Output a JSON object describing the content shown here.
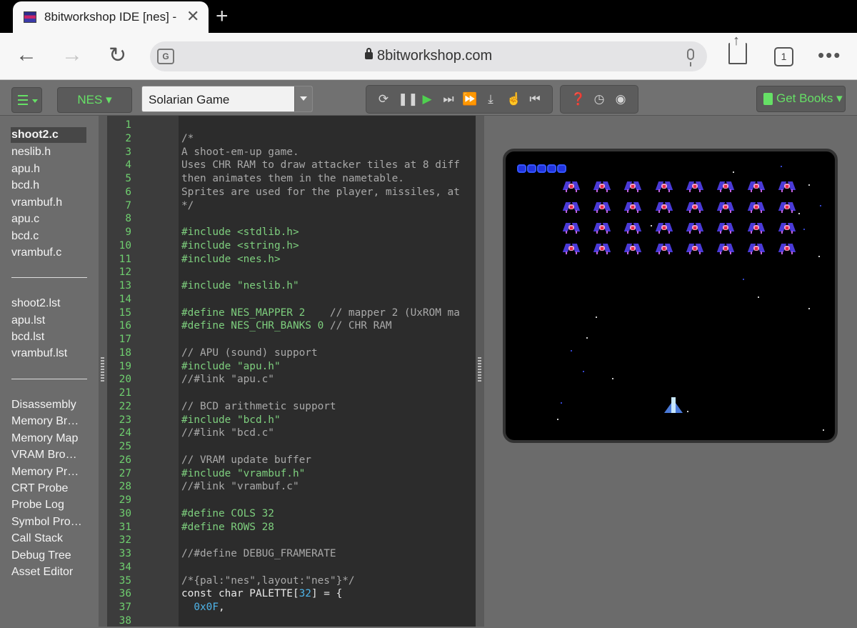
{
  "browser": {
    "tab_title": "8bitworkshop IDE [nes] - ",
    "url": "8bitworkshop.com",
    "tab_count": "1"
  },
  "ide": {
    "platform": "NES",
    "preset": "Solarian Game",
    "books": "Get Books",
    "controls": [
      "reset-icon",
      "pause-icon",
      "play-icon",
      "step-icon",
      "fast-forward-icon",
      "download-icon",
      "touch-icon",
      "rewind-icon"
    ],
    "debug_controls": [
      "help-icon",
      "clock-icon",
      "record-icon"
    ]
  },
  "sidebar": {
    "sources": [
      "shoot2.c",
      "neslib.h",
      "apu.h",
      "bcd.h",
      "vrambuf.h",
      "apu.c",
      "bcd.c",
      "vrambuf.c"
    ],
    "listings": [
      "shoot2.lst",
      "apu.lst",
      "bcd.lst",
      "vrambuf.lst"
    ],
    "tools": [
      "Disassembly",
      "Memory Br…",
      "Memory Map",
      "VRAM Bro…",
      "Memory Pr…",
      "CRT Probe",
      "Probe Log",
      "Symbol Pro…",
      "Call Stack",
      "Debug Tree",
      "Asset Editor"
    ],
    "active": "shoot2.c"
  },
  "editor": {
    "lines": [
      {
        "n": "1",
        "t": "",
        "c": "t-plain"
      },
      {
        "n": "2",
        "t": "/*",
        "c": "t-comment"
      },
      {
        "n": "3",
        "t": "A shoot-em-up game.",
        "c": "t-comment"
      },
      {
        "n": "4",
        "t": "Uses CHR RAM to draw attacker tiles at 8 diff",
        "c": "t-comment"
      },
      {
        "n": "5",
        "t": "then animates them in the nametable.",
        "c": "t-comment"
      },
      {
        "n": "6",
        "t": "Sprites are used for the player, missiles, at",
        "c": "t-comment"
      },
      {
        "n": "7",
        "t": "*/",
        "c": "t-comment"
      },
      {
        "n": "8",
        "t": "",
        "c": "t-plain"
      },
      {
        "n": "9",
        "t": "#include <stdlib.h>",
        "c": "t-pre"
      },
      {
        "n": "10",
        "t": "#include <string.h>",
        "c": "t-pre"
      },
      {
        "n": "11",
        "t": "#include <nes.h>",
        "c": "t-pre"
      },
      {
        "n": "12",
        "t": "",
        "c": "t-plain"
      },
      {
        "n": "13",
        "t": "#include \"neslib.h\"",
        "c": "t-pre"
      },
      {
        "n": "14",
        "t": "",
        "c": "t-plain"
      },
      {
        "n": "15",
        "t": "#define NES_MAPPER 2",
        "c": "t-pre",
        "x": "    // mapper 2 (UxROM ma"
      },
      {
        "n": "16",
        "t": "#define NES_CHR_BANKS 0",
        "c": "t-pre",
        "x": " // CHR RAM"
      },
      {
        "n": "17",
        "t": "",
        "c": "t-plain"
      },
      {
        "n": "18",
        "t": "// APU (sound) support",
        "c": "t-comment"
      },
      {
        "n": "19",
        "t": "#include \"apu.h\"",
        "c": "t-pre"
      },
      {
        "n": "20",
        "t": "//#link \"apu.c\"",
        "c": "t-comment"
      },
      {
        "n": "21",
        "t": "",
        "c": "t-plain"
      },
      {
        "n": "22",
        "t": "// BCD arithmetic support",
        "c": "t-comment"
      },
      {
        "n": "23",
        "t": "#include \"bcd.h\"",
        "c": "t-pre"
      },
      {
        "n": "24",
        "t": "//#link \"bcd.c\"",
        "c": "t-comment"
      },
      {
        "n": "25",
        "t": "",
        "c": "t-plain"
      },
      {
        "n": "26",
        "t": "// VRAM update buffer",
        "c": "t-comment"
      },
      {
        "n": "27",
        "t": "#include \"vrambuf.h\"",
        "c": "t-pre"
      },
      {
        "n": "28",
        "t": "//#link \"vrambuf.c\"",
        "c": "t-comment"
      },
      {
        "n": "29",
        "t": "",
        "c": "t-plain"
      },
      {
        "n": "30",
        "t": "#define COLS 32",
        "c": "t-pre"
      },
      {
        "n": "31",
        "t": "#define ROWS 28",
        "c": "t-pre"
      },
      {
        "n": "32",
        "t": "",
        "c": "t-plain"
      },
      {
        "n": "33",
        "t": "//#define DEBUG_FRAMERATE",
        "c": "t-comment"
      },
      {
        "n": "34",
        "t": "",
        "c": "t-plain"
      },
      {
        "n": "35",
        "t": "/*{pal:\"nes\",layout:\"nes\"}*/",
        "c": "t-comment"
      },
      {
        "n": "36",
        "t": "const char PALETTE[",
        "c": "t-plain",
        "num": "32",
        "tail": "] = {"
      },
      {
        "n": "37",
        "t": "  ",
        "c": "t-plain",
        "num": "0x0F",
        "tail": ","
      },
      {
        "n": "38",
        "t": "",
        "c": "t-plain"
      }
    ]
  }
}
